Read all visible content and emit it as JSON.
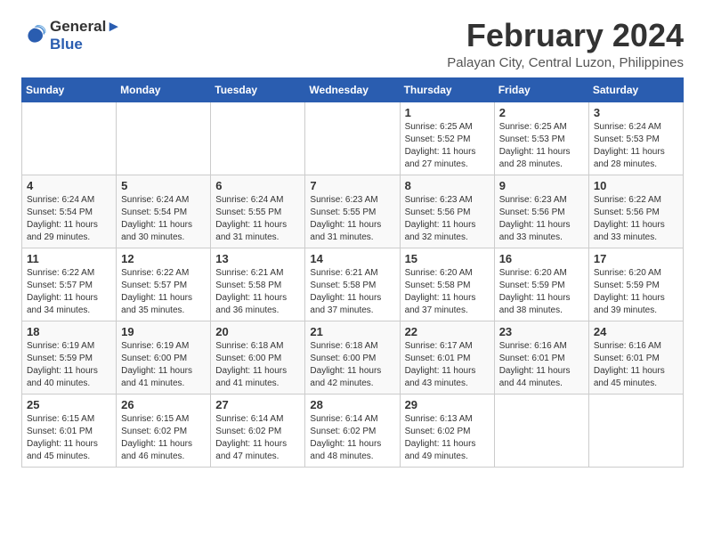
{
  "logo": {
    "line1": "General",
    "line2": "Blue"
  },
  "title": "February 2024",
  "subtitle": "Palayan City, Central Luzon, Philippines",
  "weekdays": [
    "Sunday",
    "Monday",
    "Tuesday",
    "Wednesday",
    "Thursday",
    "Friday",
    "Saturday"
  ],
  "weeks": [
    [
      {
        "day": "",
        "info": ""
      },
      {
        "day": "",
        "info": ""
      },
      {
        "day": "",
        "info": ""
      },
      {
        "day": "",
        "info": ""
      },
      {
        "day": "1",
        "info": "Sunrise: 6:25 AM\nSunset: 5:52 PM\nDaylight: 11 hours and 27 minutes."
      },
      {
        "day": "2",
        "info": "Sunrise: 6:25 AM\nSunset: 5:53 PM\nDaylight: 11 hours and 28 minutes."
      },
      {
        "day": "3",
        "info": "Sunrise: 6:24 AM\nSunset: 5:53 PM\nDaylight: 11 hours and 28 minutes."
      }
    ],
    [
      {
        "day": "4",
        "info": "Sunrise: 6:24 AM\nSunset: 5:54 PM\nDaylight: 11 hours and 29 minutes."
      },
      {
        "day": "5",
        "info": "Sunrise: 6:24 AM\nSunset: 5:54 PM\nDaylight: 11 hours and 30 minutes."
      },
      {
        "day": "6",
        "info": "Sunrise: 6:24 AM\nSunset: 5:55 PM\nDaylight: 11 hours and 31 minutes."
      },
      {
        "day": "7",
        "info": "Sunrise: 6:23 AM\nSunset: 5:55 PM\nDaylight: 11 hours and 31 minutes."
      },
      {
        "day": "8",
        "info": "Sunrise: 6:23 AM\nSunset: 5:56 PM\nDaylight: 11 hours and 32 minutes."
      },
      {
        "day": "9",
        "info": "Sunrise: 6:23 AM\nSunset: 5:56 PM\nDaylight: 11 hours and 33 minutes."
      },
      {
        "day": "10",
        "info": "Sunrise: 6:22 AM\nSunset: 5:56 PM\nDaylight: 11 hours and 33 minutes."
      }
    ],
    [
      {
        "day": "11",
        "info": "Sunrise: 6:22 AM\nSunset: 5:57 PM\nDaylight: 11 hours and 34 minutes."
      },
      {
        "day": "12",
        "info": "Sunrise: 6:22 AM\nSunset: 5:57 PM\nDaylight: 11 hours and 35 minutes."
      },
      {
        "day": "13",
        "info": "Sunrise: 6:21 AM\nSunset: 5:58 PM\nDaylight: 11 hours and 36 minutes."
      },
      {
        "day": "14",
        "info": "Sunrise: 6:21 AM\nSunset: 5:58 PM\nDaylight: 11 hours and 37 minutes."
      },
      {
        "day": "15",
        "info": "Sunrise: 6:20 AM\nSunset: 5:58 PM\nDaylight: 11 hours and 37 minutes."
      },
      {
        "day": "16",
        "info": "Sunrise: 6:20 AM\nSunset: 5:59 PM\nDaylight: 11 hours and 38 minutes."
      },
      {
        "day": "17",
        "info": "Sunrise: 6:20 AM\nSunset: 5:59 PM\nDaylight: 11 hours and 39 minutes."
      }
    ],
    [
      {
        "day": "18",
        "info": "Sunrise: 6:19 AM\nSunset: 5:59 PM\nDaylight: 11 hours and 40 minutes."
      },
      {
        "day": "19",
        "info": "Sunrise: 6:19 AM\nSunset: 6:00 PM\nDaylight: 11 hours and 41 minutes."
      },
      {
        "day": "20",
        "info": "Sunrise: 6:18 AM\nSunset: 6:00 PM\nDaylight: 11 hours and 41 minutes."
      },
      {
        "day": "21",
        "info": "Sunrise: 6:18 AM\nSunset: 6:00 PM\nDaylight: 11 hours and 42 minutes."
      },
      {
        "day": "22",
        "info": "Sunrise: 6:17 AM\nSunset: 6:01 PM\nDaylight: 11 hours and 43 minutes."
      },
      {
        "day": "23",
        "info": "Sunrise: 6:16 AM\nSunset: 6:01 PM\nDaylight: 11 hours and 44 minutes."
      },
      {
        "day": "24",
        "info": "Sunrise: 6:16 AM\nSunset: 6:01 PM\nDaylight: 11 hours and 45 minutes."
      }
    ],
    [
      {
        "day": "25",
        "info": "Sunrise: 6:15 AM\nSunset: 6:01 PM\nDaylight: 11 hours and 45 minutes."
      },
      {
        "day": "26",
        "info": "Sunrise: 6:15 AM\nSunset: 6:02 PM\nDaylight: 11 hours and 46 minutes."
      },
      {
        "day": "27",
        "info": "Sunrise: 6:14 AM\nSunset: 6:02 PM\nDaylight: 11 hours and 47 minutes."
      },
      {
        "day": "28",
        "info": "Sunrise: 6:14 AM\nSunset: 6:02 PM\nDaylight: 11 hours and 48 minutes."
      },
      {
        "day": "29",
        "info": "Sunrise: 6:13 AM\nSunset: 6:02 PM\nDaylight: 11 hours and 49 minutes."
      },
      {
        "day": "",
        "info": ""
      },
      {
        "day": "",
        "info": ""
      }
    ]
  ]
}
